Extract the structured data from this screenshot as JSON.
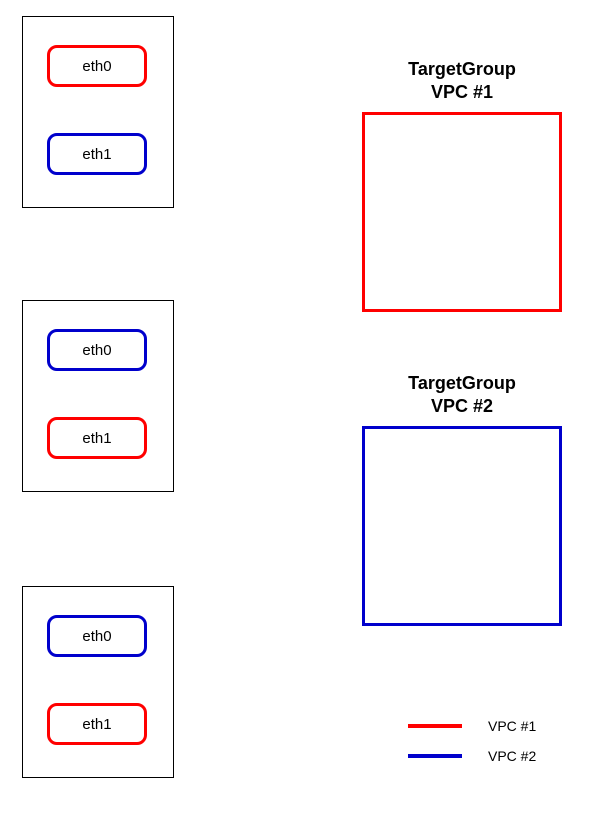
{
  "instances": [
    {
      "ifaces": [
        {
          "label": "eth0",
          "color": "red"
        },
        {
          "label": "eth1",
          "color": "blue"
        }
      ]
    },
    {
      "ifaces": [
        {
          "label": "eth0",
          "color": "blue"
        },
        {
          "label": "eth1",
          "color": "red"
        }
      ]
    },
    {
      "ifaces": [
        {
          "label": "eth0",
          "color": "blue"
        },
        {
          "label": "eth1",
          "color": "red"
        }
      ]
    }
  ],
  "targetGroups": [
    {
      "title_line1": "TargetGroup",
      "title_line2": "VPC #1",
      "color": "red"
    },
    {
      "title_line1": "TargetGroup",
      "title_line2": "VPC #2",
      "color": "blue"
    }
  ],
  "legend": [
    {
      "label": "VPC #1",
      "color": "red"
    },
    {
      "label": "VPC #2",
      "color": "blue"
    }
  ],
  "colors": {
    "red": "#ff0000",
    "blue": "#0000cc"
  }
}
